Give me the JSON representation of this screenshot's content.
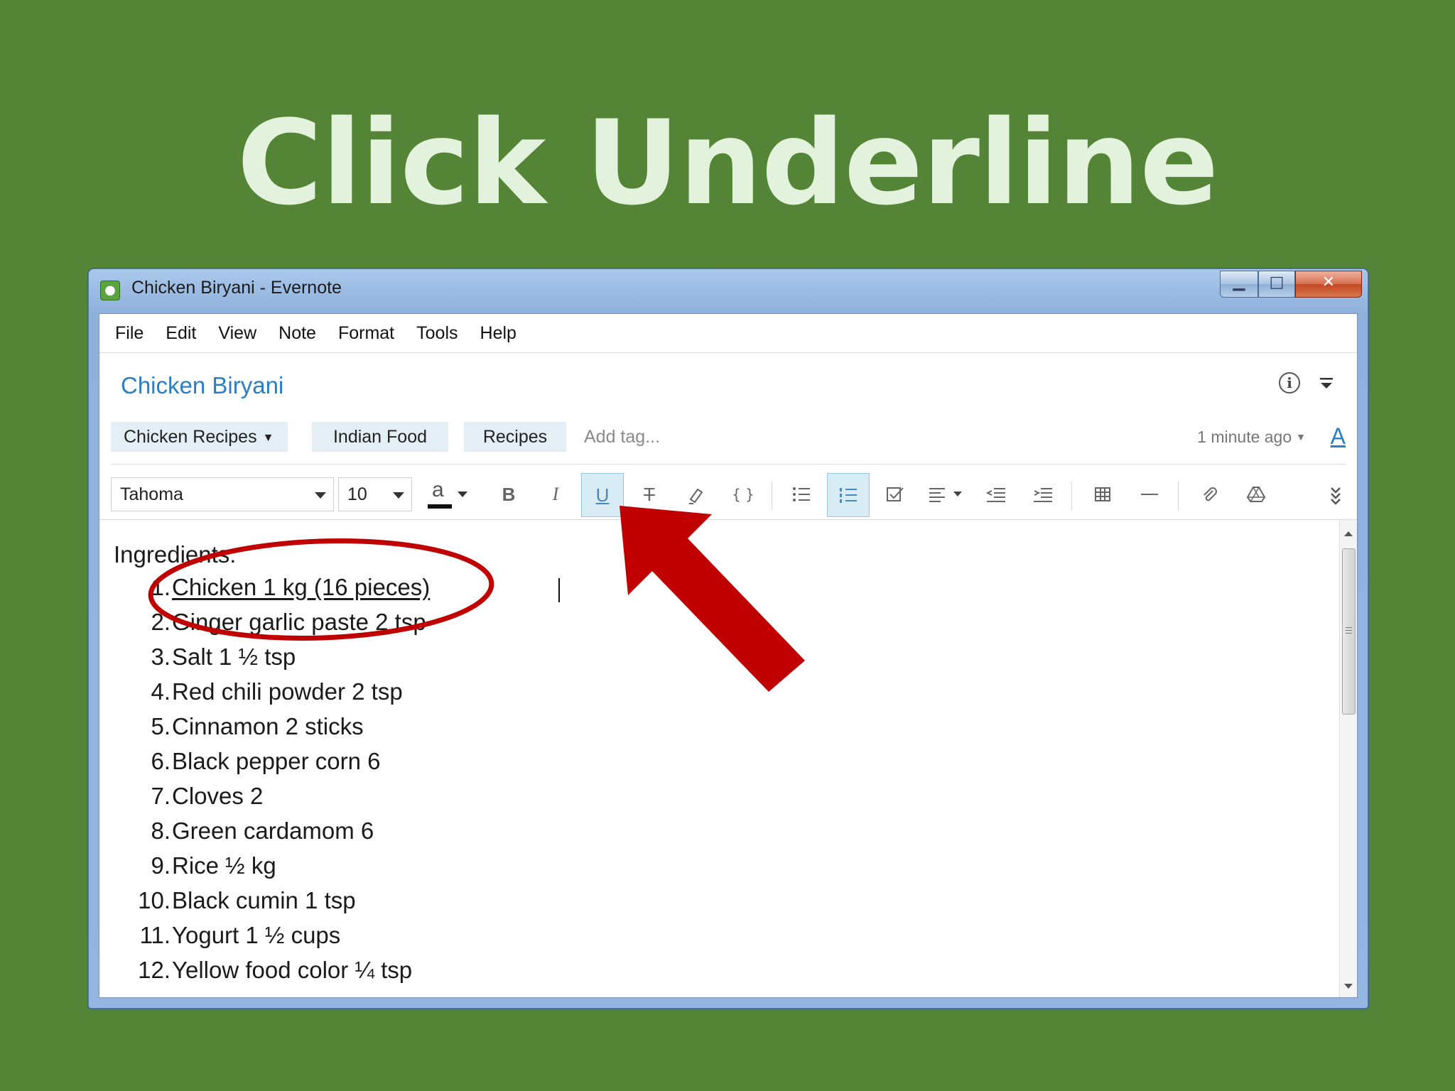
{
  "slide": {
    "title": "Click Underline"
  },
  "window": {
    "title": "Chicken Biryani - Evernote",
    "controls": {
      "minimize": "▁",
      "maximize": "□",
      "close": "✕"
    }
  },
  "menu": [
    "File",
    "Edit",
    "View",
    "Note",
    "Format",
    "Tools",
    "Help"
  ],
  "note": {
    "title": "Chicken Biryani",
    "notebook": "Chicken Recipes",
    "tags": [
      "Indian Food",
      "Recipes"
    ],
    "add_tag_placeholder": "Add tag...",
    "updated": "1 minute ago"
  },
  "toolbar": {
    "font": "Tahoma",
    "size": "10",
    "text_color_glyph": "a",
    "bold": "B",
    "italic": "I",
    "underline": "U",
    "strikethrough": "T",
    "code": "{ }",
    "text_color_swatch": "#111111",
    "active_underline": true,
    "active_numbered_list": true
  },
  "body": {
    "heading": "Ingredients:",
    "items": [
      {
        "num": "1.",
        "text": "Chicken 1 kg (16 pieces)"
      },
      {
        "num": "2.",
        "text": "Ginger garlic paste 2 tsp"
      },
      {
        "num": "3.",
        "text": "Salt 1 ½ tsp"
      },
      {
        "num": "4.",
        "text": "Red chili powder 2 tsp"
      },
      {
        "num": "5.",
        "text": "Cinnamon 2 sticks"
      },
      {
        "num": "6.",
        "text": "Black pepper corn 6"
      },
      {
        "num": "7.",
        "text": "Cloves 2"
      },
      {
        "num": "8.",
        "text": "Green cardamom 6"
      },
      {
        "num": "9.",
        "text": "Rice ½ kg"
      },
      {
        "num": "10.",
        "text": "Black cumin 1 tsp"
      },
      {
        "num": "11.",
        "text": "Yogurt 1 ½ cups"
      },
      {
        "num": "12.",
        "text": "Yellow food color ¼ tsp"
      }
    ]
  },
  "annotation": {
    "circle_color": "#c00000",
    "arrow_color": "#c00000"
  }
}
